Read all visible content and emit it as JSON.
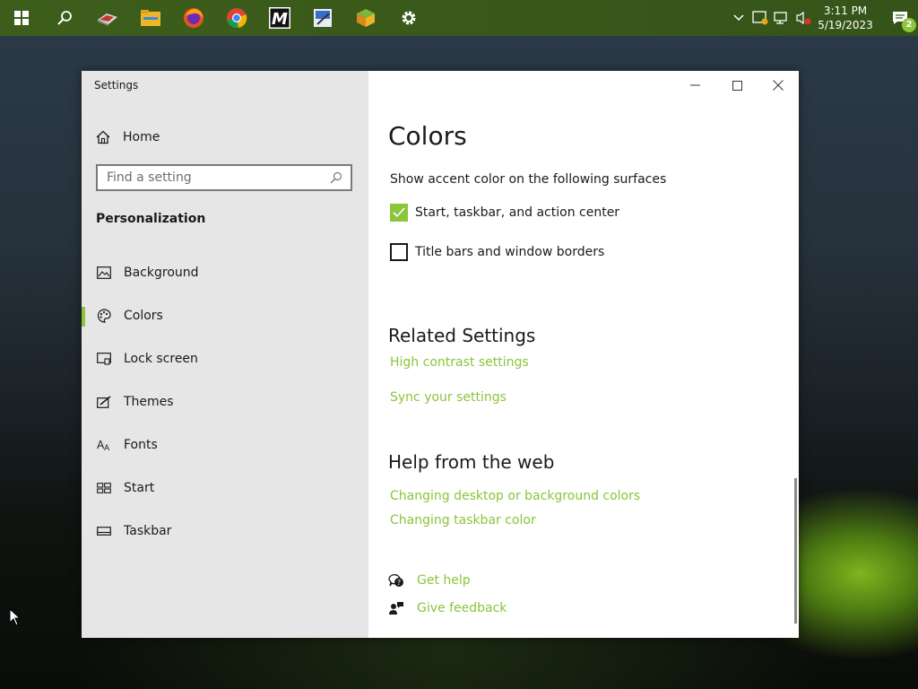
{
  "taskbar": {
    "clock_time": "3:11 PM",
    "clock_date": "5/19/2023",
    "notification_count": "2",
    "app_icons": [
      "windows-start-icon",
      "search-icon",
      "app-red-icon",
      "file-explorer-icon",
      "firefox-icon",
      "chrome-icon",
      "m-app-icon",
      "paint-icon",
      "cube-app-icon",
      "settings-gear-icon"
    ]
  },
  "window": {
    "title": "Settings"
  },
  "sidebar": {
    "home_label": "Home",
    "search_placeholder": "Find a setting",
    "section_title": "Personalization",
    "items": [
      {
        "label": "Background",
        "icon": "image-icon"
      },
      {
        "label": "Colors",
        "icon": "palette-icon",
        "active": true
      },
      {
        "label": "Lock screen",
        "icon": "lock-screen-icon"
      },
      {
        "label": "Themes",
        "icon": "themes-icon"
      },
      {
        "label": "Fonts",
        "icon": "fonts-icon"
      },
      {
        "label": "Start",
        "icon": "start-icon"
      },
      {
        "label": "Taskbar",
        "icon": "taskbar-icon"
      }
    ]
  },
  "main": {
    "title": "Colors",
    "accent_desc": "Show accent color on the following surfaces",
    "checkbox_start": "Start, taskbar, and action center",
    "checkbox_title": "Title bars and window borders",
    "related_heading": "Related Settings",
    "related_links": [
      "High contrast settings",
      "Sync your settings"
    ],
    "help_heading": "Help from the web",
    "help_links": [
      "Changing desktop or background colors",
      "Changing taskbar color"
    ],
    "get_help": "Get help",
    "give_feedback": "Give feedback"
  },
  "colors": {
    "accent": "#8ac53a",
    "taskbar": "#3d5e1b"
  }
}
